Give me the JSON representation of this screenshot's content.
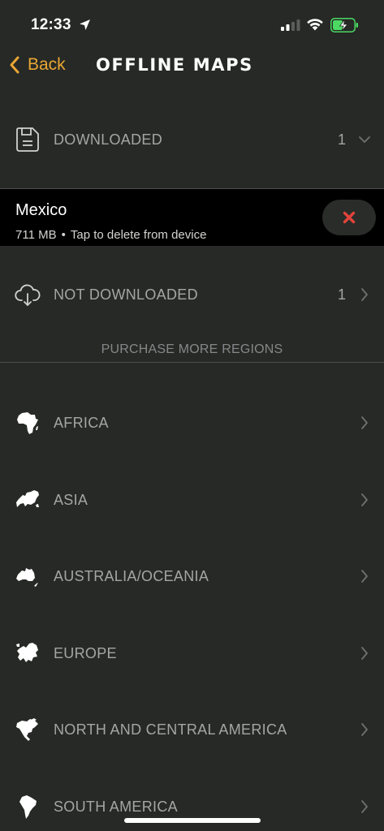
{
  "status_bar": {
    "time": "12:33"
  },
  "nav": {
    "back_label": "Back",
    "title": "OFFLINE MAPS"
  },
  "downloaded": {
    "label": "DOWNLOADED",
    "count": "1",
    "icon": "floppy-disk-icon"
  },
  "downloaded_item": {
    "name": "Mexico",
    "size": "711 MB",
    "separator": "•",
    "hint": "Tap to delete from device",
    "delete_icon": "close-x-icon",
    "delete_color": "#e0443a"
  },
  "not_downloaded": {
    "label": "NOT DOWNLOADED",
    "count": "1",
    "icon": "cloud-download-icon"
  },
  "purchase_header": "PURCHASE MORE REGIONS",
  "regions": [
    {
      "label": "AFRICA",
      "icon": "africa-map-icon"
    },
    {
      "label": "ASIA",
      "icon": "asia-map-icon"
    },
    {
      "label": "AUSTRALIA/OCEANIA",
      "icon": "australia-map-icon"
    },
    {
      "label": "EUROPE",
      "icon": "europe-map-icon"
    },
    {
      "label": "NORTH AND CENTRAL AMERICA",
      "icon": "north-america-map-icon"
    },
    {
      "label": "SOUTH AMERICA",
      "icon": "south-america-map-icon"
    }
  ],
  "colors": {
    "background": "#262925",
    "accent": "#e8a634",
    "row_text": "#a3a6a1",
    "selected_bg": "#000000",
    "battery_charge": "#4cd964"
  }
}
